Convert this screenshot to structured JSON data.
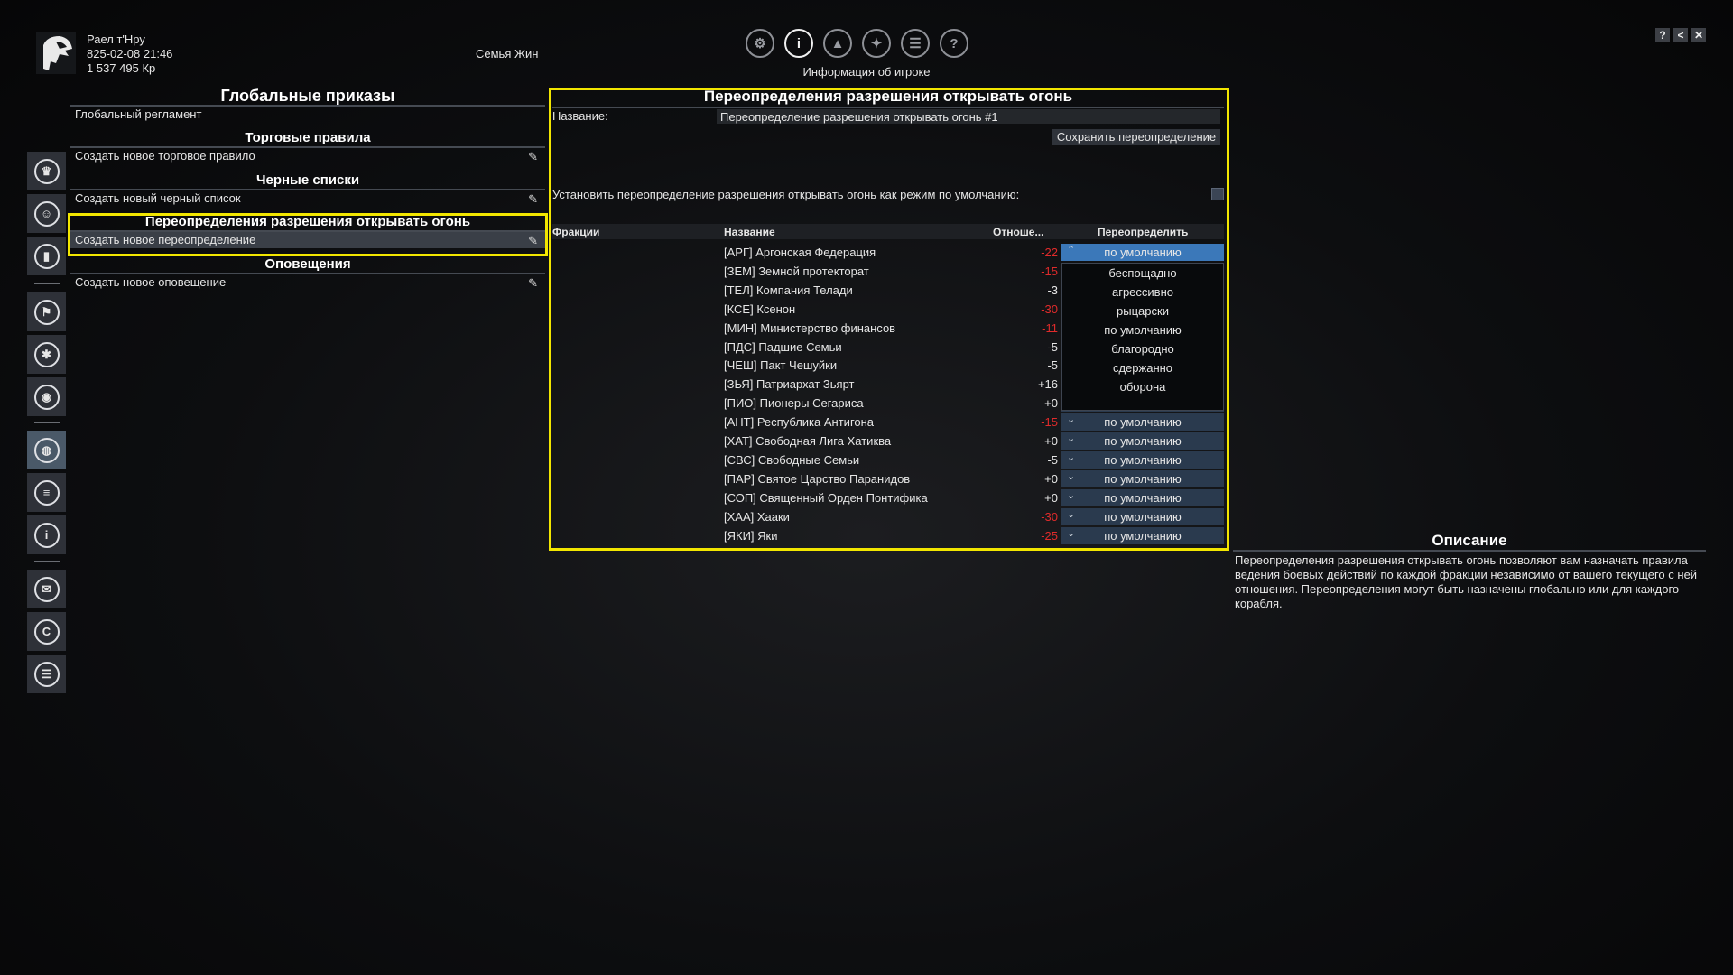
{
  "player": {
    "name": "Раел т'Нру",
    "datetime": "825-02-08 21:46",
    "credits": "1 537 495 Кр"
  },
  "family": "Семья Жин",
  "top_icons": [
    {
      "name": "gear-icon",
      "glyph": "⚙"
    },
    {
      "name": "player-info-icon",
      "glyph": "i"
    },
    {
      "name": "ship-icon",
      "glyph": "▲"
    },
    {
      "name": "map-icon",
      "glyph": "✦"
    },
    {
      "name": "logbook-icon",
      "glyph": "☰"
    },
    {
      "name": "help-icon",
      "glyph": "?"
    }
  ],
  "top_subtitle": "Информация об игроке",
  "window_controls": [
    "?",
    "<",
    "✕"
  ],
  "left_icons": [
    {
      "name": "crown-icon",
      "glyph": "♛"
    },
    {
      "name": "people-icon",
      "glyph": "☺"
    },
    {
      "name": "stats-icon",
      "glyph": "▮"
    },
    {
      "name": "faction-icon",
      "glyph": "⚑"
    },
    {
      "name": "research-icon",
      "glyph": "✱"
    },
    {
      "name": "inventory-icon",
      "glyph": "◉"
    },
    {
      "name": "globe-icon",
      "glyph": "◍"
    },
    {
      "name": "list-icon",
      "glyph": "≡"
    },
    {
      "name": "info-icon",
      "glyph": "i"
    },
    {
      "name": "mail-icon",
      "glyph": "✉"
    },
    {
      "name": "credits-icon",
      "glyph": "C"
    },
    {
      "name": "database-icon",
      "glyph": "☰"
    }
  ],
  "orders": {
    "title": "Глобальные приказы",
    "global_regulation": "Глобальный регламент",
    "trade_title": "Торговые правила",
    "trade_create": "Создать новое торговое правило",
    "blacklist_title": "Черные списки",
    "blacklist_create": "Создать новый черный список",
    "fire_title": "Переопределения разрешения открывать огонь",
    "fire_create": "Создать новое переопределение",
    "alerts_title": "Оповещения",
    "alerts_create": "Создать новое оповещение"
  },
  "panel": {
    "title": "Переопределения разрешения открывать огонь",
    "name_label": "Название:",
    "name_value": "Переопределение разрешения открывать огонь #1",
    "save_button": "Сохранить переопределение",
    "default_label": "Установить переопределение разрешения открывать огонь как режим по умолчанию:",
    "columns": {
      "factions": "Фракции",
      "name": "Название",
      "relation": "Отноше...",
      "override": "Переопределить"
    },
    "rows": [
      {
        "name": "[АРГ] Аргонская Федерация",
        "relation": "-22",
        "neg": true,
        "override": "по умолчанию"
      },
      {
        "name": "[ЗЕМ] Земной протекторат",
        "relation": "-15",
        "neg": true,
        "override": ""
      },
      {
        "name": "[ТЕЛ] Компания Телади",
        "relation": "-3",
        "neg": false,
        "override": ""
      },
      {
        "name": "[КСЕ] Ксенон",
        "relation": "-30",
        "neg": true,
        "override": ""
      },
      {
        "name": "[МИН] Министерство финансов",
        "relation": "-11",
        "neg": true,
        "override": ""
      },
      {
        "name": "[ПДС] Падшие Семьи",
        "relation": "-5",
        "neg": false,
        "override": ""
      },
      {
        "name": "[ЧЕШ] Пакт Чешуйки",
        "relation": "-5",
        "neg": false,
        "override": ""
      },
      {
        "name": "[ЗЬЯ] Патриархат Зьярт",
        "relation": "+16",
        "neg": false,
        "override": ""
      },
      {
        "name": "[ПИО] Пионеры Сегариса",
        "relation": "+0",
        "neg": false,
        "override": "по умолчанию"
      },
      {
        "name": "[АНТ] Республика Антигона",
        "relation": "-15",
        "neg": true,
        "override": "по умолчанию"
      },
      {
        "name": "[ХАТ] Свободная Лига Хатиква",
        "relation": "+0",
        "neg": false,
        "override": "по умолчанию"
      },
      {
        "name": "[СВС] Свободные Семьи",
        "relation": "-5",
        "neg": false,
        "override": "по умолчанию"
      },
      {
        "name": "[ПАР] Святое Царство Паранидов",
        "relation": "+0",
        "neg": false,
        "override": "по умолчанию"
      },
      {
        "name": "[СОП] Священный Орден Понтифика",
        "relation": "+0",
        "neg": false,
        "override": "по умолчанию"
      },
      {
        "name": "[ХАА] Хааки",
        "relation": "-30",
        "neg": true,
        "override": "по умолчанию"
      },
      {
        "name": "[ЯКИ] Яки",
        "relation": "-25",
        "neg": true,
        "override": "по умолчанию"
      }
    ],
    "dropdown_options": [
      "беспощадно",
      "агрессивно",
      "рыцарски",
      "по умолчанию",
      "благородно",
      "сдержанно",
      "оборона"
    ]
  },
  "description": {
    "title": "Описание",
    "text": "Переопределения разрешения открывать огонь позволяют вам назначать правила ведения боевых действий по каждой фракции независимо от вашего текущего с ней отношения. Переопределения могут быть назначены глобально или для каждого корабля."
  },
  "colors": {
    "highlight": "#f2e600",
    "negative": "#e02b2b",
    "dropdown_selected": "#3b78b9",
    "dropdown": "#2a3a4e"
  }
}
